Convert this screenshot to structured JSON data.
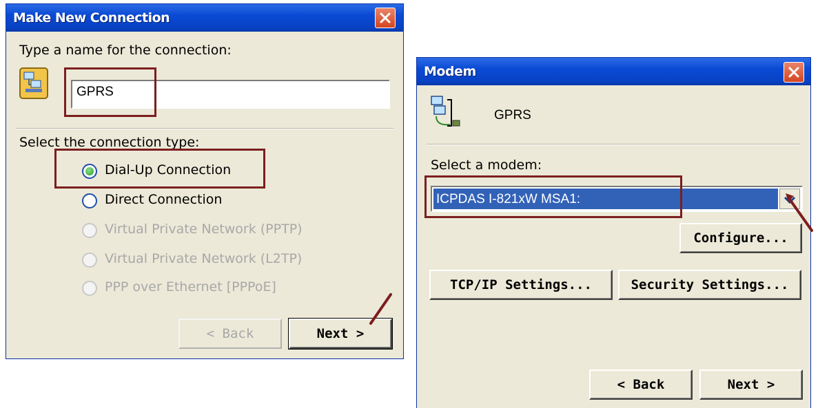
{
  "left_dialog": {
    "title": "Make New Connection",
    "name_prompt": "Type a name for the connection:",
    "name_value": "GPRS",
    "type_prompt": "Select the connection type:",
    "options": [
      {
        "label": "Dial-Up Connection",
        "selected": true,
        "enabled": true
      },
      {
        "label": "Direct Connection",
        "selected": false,
        "enabled": true
      },
      {
        "label": "Virtual Private Network (PPTP)",
        "selected": false,
        "enabled": false
      },
      {
        "label": "Virtual Private Network (L2TP)",
        "selected": false,
        "enabled": false
      },
      {
        "label": "PPP over Ethernet [PPPoE]",
        "selected": false,
        "enabled": false
      }
    ],
    "back_label": "< Back",
    "next_label": "Next >"
  },
  "right_dialog": {
    "title": "Modem",
    "connection_name": "GPRS",
    "modem_prompt": "Select a modem:",
    "modem_value": "ICPDAS I-821xW MSA1:",
    "configure_label": "Configure...",
    "tcpip_label": "TCP/IP Settings...",
    "security_label": "Security Settings...",
    "back_label": "< Back",
    "next_label": "Next >"
  },
  "colors": {
    "titlebar": "#0a4ad4",
    "dialog_bg": "#ece9d8",
    "highlight": "#7b1e1e",
    "selection": "#3262b8"
  }
}
